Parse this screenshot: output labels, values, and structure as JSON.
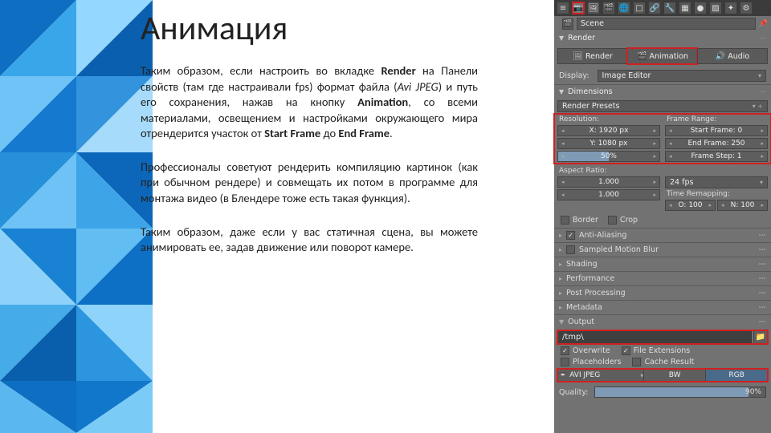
{
  "title": "Анимация",
  "p1_pre": "Таким образом, если настроить во вкладке ",
  "p1_b1": "Render",
  "p1_mid1": " на Панели свойств (там где настраивали fps) формат файла (",
  "p1_i1": "Avi JPEG",
  "p1_mid2": ") и путь его сохранения, нажав на кнопку ",
  "p1_b2": "Animation",
  "p1_mid3": ", со всеми материалами, освещением и настройками окружающего мира отрендерится участок от ",
  "p1_b3": "Start Frame",
  "p1_mid4": " до ",
  "p1_b4": "End Frame",
  "p1_end": ".",
  "p2": "Профессионалы советуют рендерить компиляцию картинок (как при обычном рендере) и совмещать их потом в программе для монтажа видео (в Блендере тоже есть такая функция).",
  "p3": "Таким образом, даже если у вас статичная сцена, вы можете анимировать ее, задав движение или поворот камере.",
  "panel": {
    "scene_name": "Scene",
    "render_section": "Render",
    "btn_render": "Render",
    "btn_animation": "Animation",
    "btn_audio": "Audio",
    "display_label": "Display:",
    "display_value": "Image Editor",
    "dimensions": "Dimensions",
    "render_presets": "Render Presets",
    "resolution": "Resolution:",
    "x_label": "X:",
    "x_val": "1920 px",
    "y_label": "Y:",
    "y_val": "1080 px",
    "pct": "50%",
    "frame_range": "Frame Range:",
    "start_l": "Start Frame:",
    "start_v": "0",
    "end_l": "End Frame:",
    "end_v": "250",
    "step_l": "Frame Step:",
    "step_v": "1",
    "aspect": "Aspect Ratio:",
    "asp_x": "1.000",
    "asp_y": "1.000",
    "fps": "24 fps",
    "time_remap": "Time Remapping:",
    "old_l": "O: 100",
    "new_l": "N: 100",
    "border": "Border",
    "crop": "Crop",
    "anti": "Anti-Aliasing",
    "mblur": "Sampled Motion Blur",
    "shading": "Shading",
    "perf": "Performance",
    "post": "Post Processing",
    "meta": "Metadata",
    "output": "Output",
    "path": "/tmp\\",
    "overwrite": "Overwrite",
    "file_ext": "File Extensions",
    "placeholders": "Placeholders",
    "cache": "Cache Result",
    "ic": "📼",
    "fmt": "AVI JPEG",
    "bw": "BW",
    "rgb": "RGB",
    "quality": "Quality:",
    "quality_v": "90%"
  }
}
